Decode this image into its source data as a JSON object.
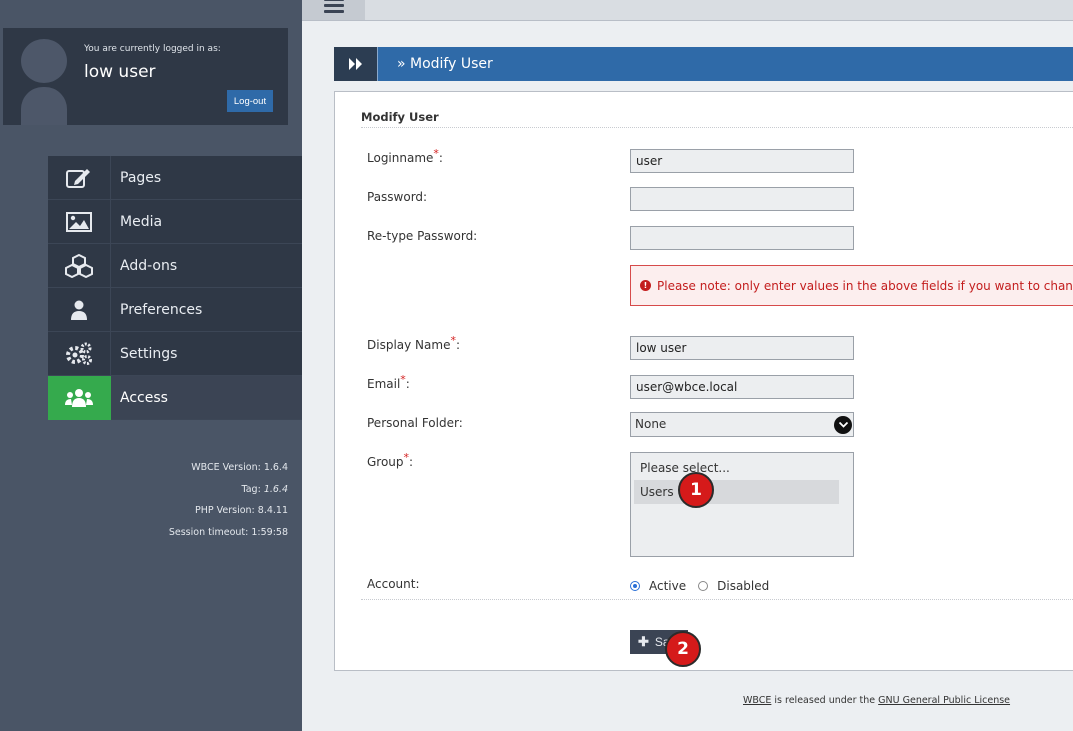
{
  "user_panel": {
    "logged_in_label": "You are currently logged in as:",
    "username": "low user",
    "logout_label": "Log-out"
  },
  "nav": {
    "items": [
      {
        "label": "Pages",
        "icon": "edit-icon"
      },
      {
        "label": "Media",
        "icon": "image-icon"
      },
      {
        "label": "Add-ons",
        "icon": "cubes-icon"
      },
      {
        "label": "Preferences",
        "icon": "user-icon"
      },
      {
        "label": "Settings",
        "icon": "gears-icon"
      },
      {
        "label": "Access",
        "icon": "users-icon",
        "active": true
      }
    ]
  },
  "versions": {
    "wbce_version": "WBCE Version: 1.6.4",
    "tag_label": "Tag:",
    "tag_value": "1.6.4",
    "php_version": "PHP Version: 8.4.11",
    "session_timeout": "Session timeout: 1:59:58"
  },
  "header": {
    "title": "» Modify User"
  },
  "form": {
    "section_title": "Modify User",
    "loginname_label": "Loginname",
    "loginname_value": "user",
    "password_label": "Password:",
    "retype_password_label": "Re-type Password:",
    "password_note": "Please note: only enter values in the above fields if you want to change t",
    "display_name_label": "Display Name",
    "display_name_value": "low user",
    "email_label": "Email",
    "email_value": "user@wbce.local",
    "personal_folder_label": "Personal Folder:",
    "personal_folder_value": "None",
    "group_label": "Group",
    "group_options": [
      "Please select...",
      "Users"
    ],
    "account_label": "Account:",
    "account_active": "Active",
    "account_disabled": "Disabled",
    "save_label": "Sa",
    "required_mark": "*",
    "colon": ":"
  },
  "callouts": [
    "1",
    "2"
  ],
  "footer": {
    "wbce_link": "WBCE",
    "middle_text": " is released under the ",
    "license_link": "GNU General Public License"
  },
  "colors": {
    "sidebar_bg": "#4a5566",
    "nav_bg": "#2f3846",
    "active_green": "#35aa4d",
    "header_blue": "#2f6aa8",
    "alert_red": "#c31d1d",
    "callout_red": "#d51a1a"
  }
}
